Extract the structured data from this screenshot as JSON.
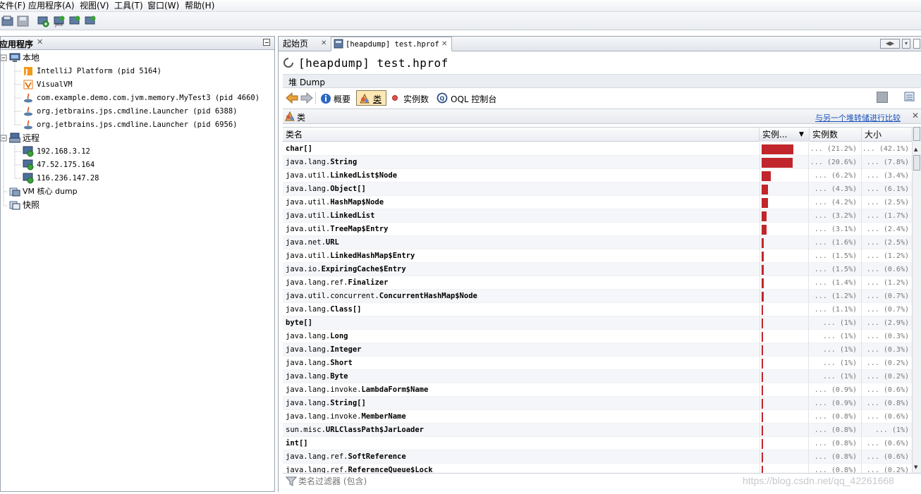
{
  "menu": [
    "文件(F)",
    "应用程序(A)",
    "视图(V)",
    "工具(T)",
    "窗口(W)",
    "帮助(H)"
  ],
  "left_panel": {
    "title": "应用程序",
    "tree": {
      "local_label": "本地",
      "local_items": [
        "IntelliJ Platform (pid 5164)",
        "VisualVM",
        "com.example.demo.com.jvm.memory.MyTest3 (pid 4660)",
        "org.jetbrains.jps.cmdline.Launcher (pid 6388)",
        "org.jetbrains.jps.cmdline.Launcher (pid 6956)"
      ],
      "remote_label": "远程",
      "remote_items": [
        "192.168.3.12",
        "47.52.175.164",
        "116.236.147.28"
      ],
      "vm_core_label": "VM 核心 dump",
      "snapshot_label": "快照"
    }
  },
  "tabs": [
    {
      "label": "起始页"
    },
    {
      "label": "[heapdump] test.hprof"
    }
  ],
  "heapdump": {
    "title": "[heapdump] test.hprof",
    "heap_label": "堆 Dump",
    "views": {
      "summary": "概要",
      "classes": "类",
      "instances": "实例数",
      "oql": "OQL 控制台"
    },
    "classes_title": "类",
    "compare_link": "与另一个堆转储进行比较",
    "filter_placeholder": "类名过滤器 (包含)"
  },
  "table": {
    "headers": {
      "name": "类名",
      "bar": "实例...",
      "count": "实例数",
      "size": "大小"
    },
    "rows": [
      {
        "pkg": "",
        "cls": "char[]",
        "bar": 21.2,
        "count": "... (21.2%)",
        "size": "... (42.1%)"
      },
      {
        "pkg": "java.lang.",
        "cls": "String",
        "bar": 20.6,
        "count": "... (20.6%)",
        "size": "... (7.8%)"
      },
      {
        "pkg": "java.util.",
        "cls": "LinkedList$Node",
        "bar": 6.2,
        "count": "... (6.2%)",
        "size": "... (3.4%)"
      },
      {
        "pkg": "java.lang.",
        "cls": "Object[]",
        "bar": 4.3,
        "count": "... (4.3%)",
        "size": "... (6.1%)"
      },
      {
        "pkg": "java.util.",
        "cls": "HashMap$Node",
        "bar": 4.2,
        "count": "... (4.2%)",
        "size": "... (2.5%)"
      },
      {
        "pkg": "java.util.",
        "cls": "LinkedList",
        "bar": 3.2,
        "count": "... (3.2%)",
        "size": "... (1.7%)"
      },
      {
        "pkg": "java.util.",
        "cls": "TreeMap$Entry",
        "bar": 3.1,
        "count": "... (3.1%)",
        "size": "... (2.4%)"
      },
      {
        "pkg": "java.net.",
        "cls": "URL",
        "bar": 1.6,
        "count": "... (1.6%)",
        "size": "... (2.5%)"
      },
      {
        "pkg": "java.util.",
        "cls": "LinkedHashMap$Entry",
        "bar": 1.5,
        "count": "... (1.5%)",
        "size": "... (1.2%)"
      },
      {
        "pkg": "java.io.",
        "cls": "ExpiringCache$Entry",
        "bar": 1.5,
        "count": "... (1.5%)",
        "size": "... (0.6%)"
      },
      {
        "pkg": "java.lang.ref.",
        "cls": "Finalizer",
        "bar": 1.4,
        "count": "... (1.4%)",
        "size": "... (1.2%)"
      },
      {
        "pkg": "java.util.concurrent.",
        "cls": "ConcurrentHashMap$Node",
        "bar": 1.2,
        "count": "... (1.2%)",
        "size": "... (0.7%)"
      },
      {
        "pkg": "java.lang.",
        "cls": "Class[]",
        "bar": 1.1,
        "count": "... (1.1%)",
        "size": "... (0.7%)"
      },
      {
        "pkg": "",
        "cls": "byte[]",
        "bar": 1.0,
        "count": "... (1%)",
        "size": "... (2.9%)"
      },
      {
        "pkg": "java.lang.",
        "cls": "Long",
        "bar": 1.0,
        "count": "... (1%)",
        "size": "... (0.3%)"
      },
      {
        "pkg": "java.lang.",
        "cls": "Integer",
        "bar": 1.0,
        "count": "... (1%)",
        "size": "... (0.3%)"
      },
      {
        "pkg": "java.lang.",
        "cls": "Short",
        "bar": 1.0,
        "count": "... (1%)",
        "size": "... (0.2%)"
      },
      {
        "pkg": "java.lang.",
        "cls": "Byte",
        "bar": 1.0,
        "count": "... (1%)",
        "size": "... (0.2%)"
      },
      {
        "pkg": "java.lang.invoke.",
        "cls": "LambdaForm$Name",
        "bar": 0.9,
        "count": "... (0.9%)",
        "size": "... (0.6%)"
      },
      {
        "pkg": "java.lang.",
        "cls": "String[]",
        "bar": 0.9,
        "count": "... (0.9%)",
        "size": "... (0.8%)"
      },
      {
        "pkg": "java.lang.invoke.",
        "cls": "MemberName",
        "bar": 0.8,
        "count": "... (0.8%)",
        "size": "... (0.6%)"
      },
      {
        "pkg": "sun.misc.",
        "cls": "URLClassPath$JarLoader",
        "bar": 0.8,
        "count": "... (0.8%)",
        "size": "... (1%)"
      },
      {
        "pkg": "",
        "cls": "int[]",
        "bar": 0.8,
        "count": "... (0.8%)",
        "size": "... (0.6%)"
      },
      {
        "pkg": "java.lang.ref.",
        "cls": "SoftReference",
        "bar": 0.8,
        "count": "... (0.8%)",
        "size": "... (0.6%)"
      },
      {
        "pkg": "java.lang.ref.",
        "cls": "ReferenceQueue$Lock",
        "bar": 0.8,
        "count": "... (0.8%)",
        "size": "... (0.2%)"
      }
    ]
  },
  "watermark": "https://blog.csdn.net/qq_42261668",
  "colors": {
    "bar": "#c0262b",
    "link": "#1a52b8"
  }
}
